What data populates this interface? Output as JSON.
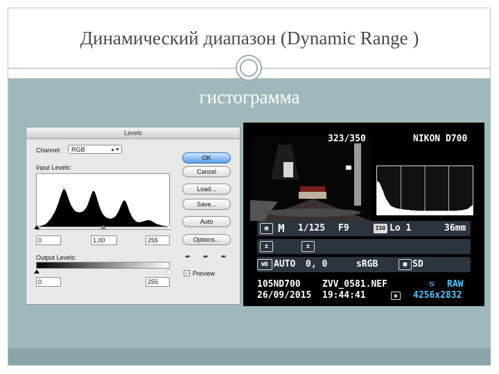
{
  "slide": {
    "title": "Динамический диапазон (Dynamic Range )",
    "subtitle": "гистограмма"
  },
  "levels_dialog": {
    "window_title": "Levels",
    "channel_label": "Channel:",
    "channel_value": "RGB",
    "input_levels_label": "Input Levels:",
    "input_black": "0",
    "input_gamma": "1,00",
    "input_white": "255",
    "output_levels_label": "Output Levels:",
    "output_black": "0",
    "output_white": "255",
    "buttons": {
      "ok": "OK",
      "cancel": "Cancel",
      "load": "Load...",
      "save": "Save...",
      "auto": "Auto",
      "options": "Options..."
    },
    "preview_label": "Preview",
    "preview_checked": true,
    "histogram_profile": [
      0,
      0,
      1,
      2,
      3,
      5,
      8,
      12,
      16,
      22,
      28,
      36,
      45,
      56,
      66,
      72,
      68,
      58,
      48,
      40,
      34,
      30,
      28,
      27,
      27,
      28,
      30,
      34,
      40,
      50,
      60,
      68,
      66,
      56,
      44,
      34,
      26,
      21,
      18,
      16,
      15,
      15,
      16,
      18,
      22,
      28,
      36,
      44,
      50,
      48,
      40,
      30,
      22,
      16,
      12,
      9,
      8,
      8,
      9,
      10,
      11,
      12,
      12,
      11,
      9,
      7,
      5,
      4,
      3,
      2,
      1,
      1,
      0,
      0
    ]
  },
  "camera": {
    "frame_counter": "323/350",
    "model": "NIKON D700",
    "shutter": "1/125",
    "aperture": "F9",
    "iso_label": "ISO",
    "iso_value": "Lo 1",
    "focal_length": "36mm",
    "metering_icon": "matrix-metering-icon",
    "mode": "M",
    "wb_label": "WB",
    "wb_value": "AUTO",
    "wb_adjust": "0, 0",
    "color_space": "sRGB",
    "picture_control": "SD",
    "folder": "105ND700",
    "filename": "ZVV_0581.NEF",
    "date": "26/09/2015",
    "time": "19:44:41",
    "quality": "RAW",
    "resolution": "4256x2832",
    "histogram_profile": [
      70,
      68,
      66,
      60,
      54,
      48,
      40,
      34,
      30,
      26,
      22,
      19,
      17,
      16,
      15,
      14,
      13,
      13,
      12,
      12,
      11,
      11,
      11,
      10,
      10,
      10,
      10,
      9,
      9,
      9,
      9,
      9,
      8,
      8,
      8,
      8,
      8,
      8,
      8,
      8,
      8,
      8,
      8,
      8,
      8,
      8,
      8,
      8,
      8,
      8,
      8,
      8,
      8,
      8,
      8,
      8,
      8,
      8,
      8,
      8,
      8,
      8,
      8,
      8,
      8,
      9,
      9,
      9,
      9,
      10,
      10,
      11,
      11,
      12,
      14,
      16,
      18,
      20
    ]
  }
}
